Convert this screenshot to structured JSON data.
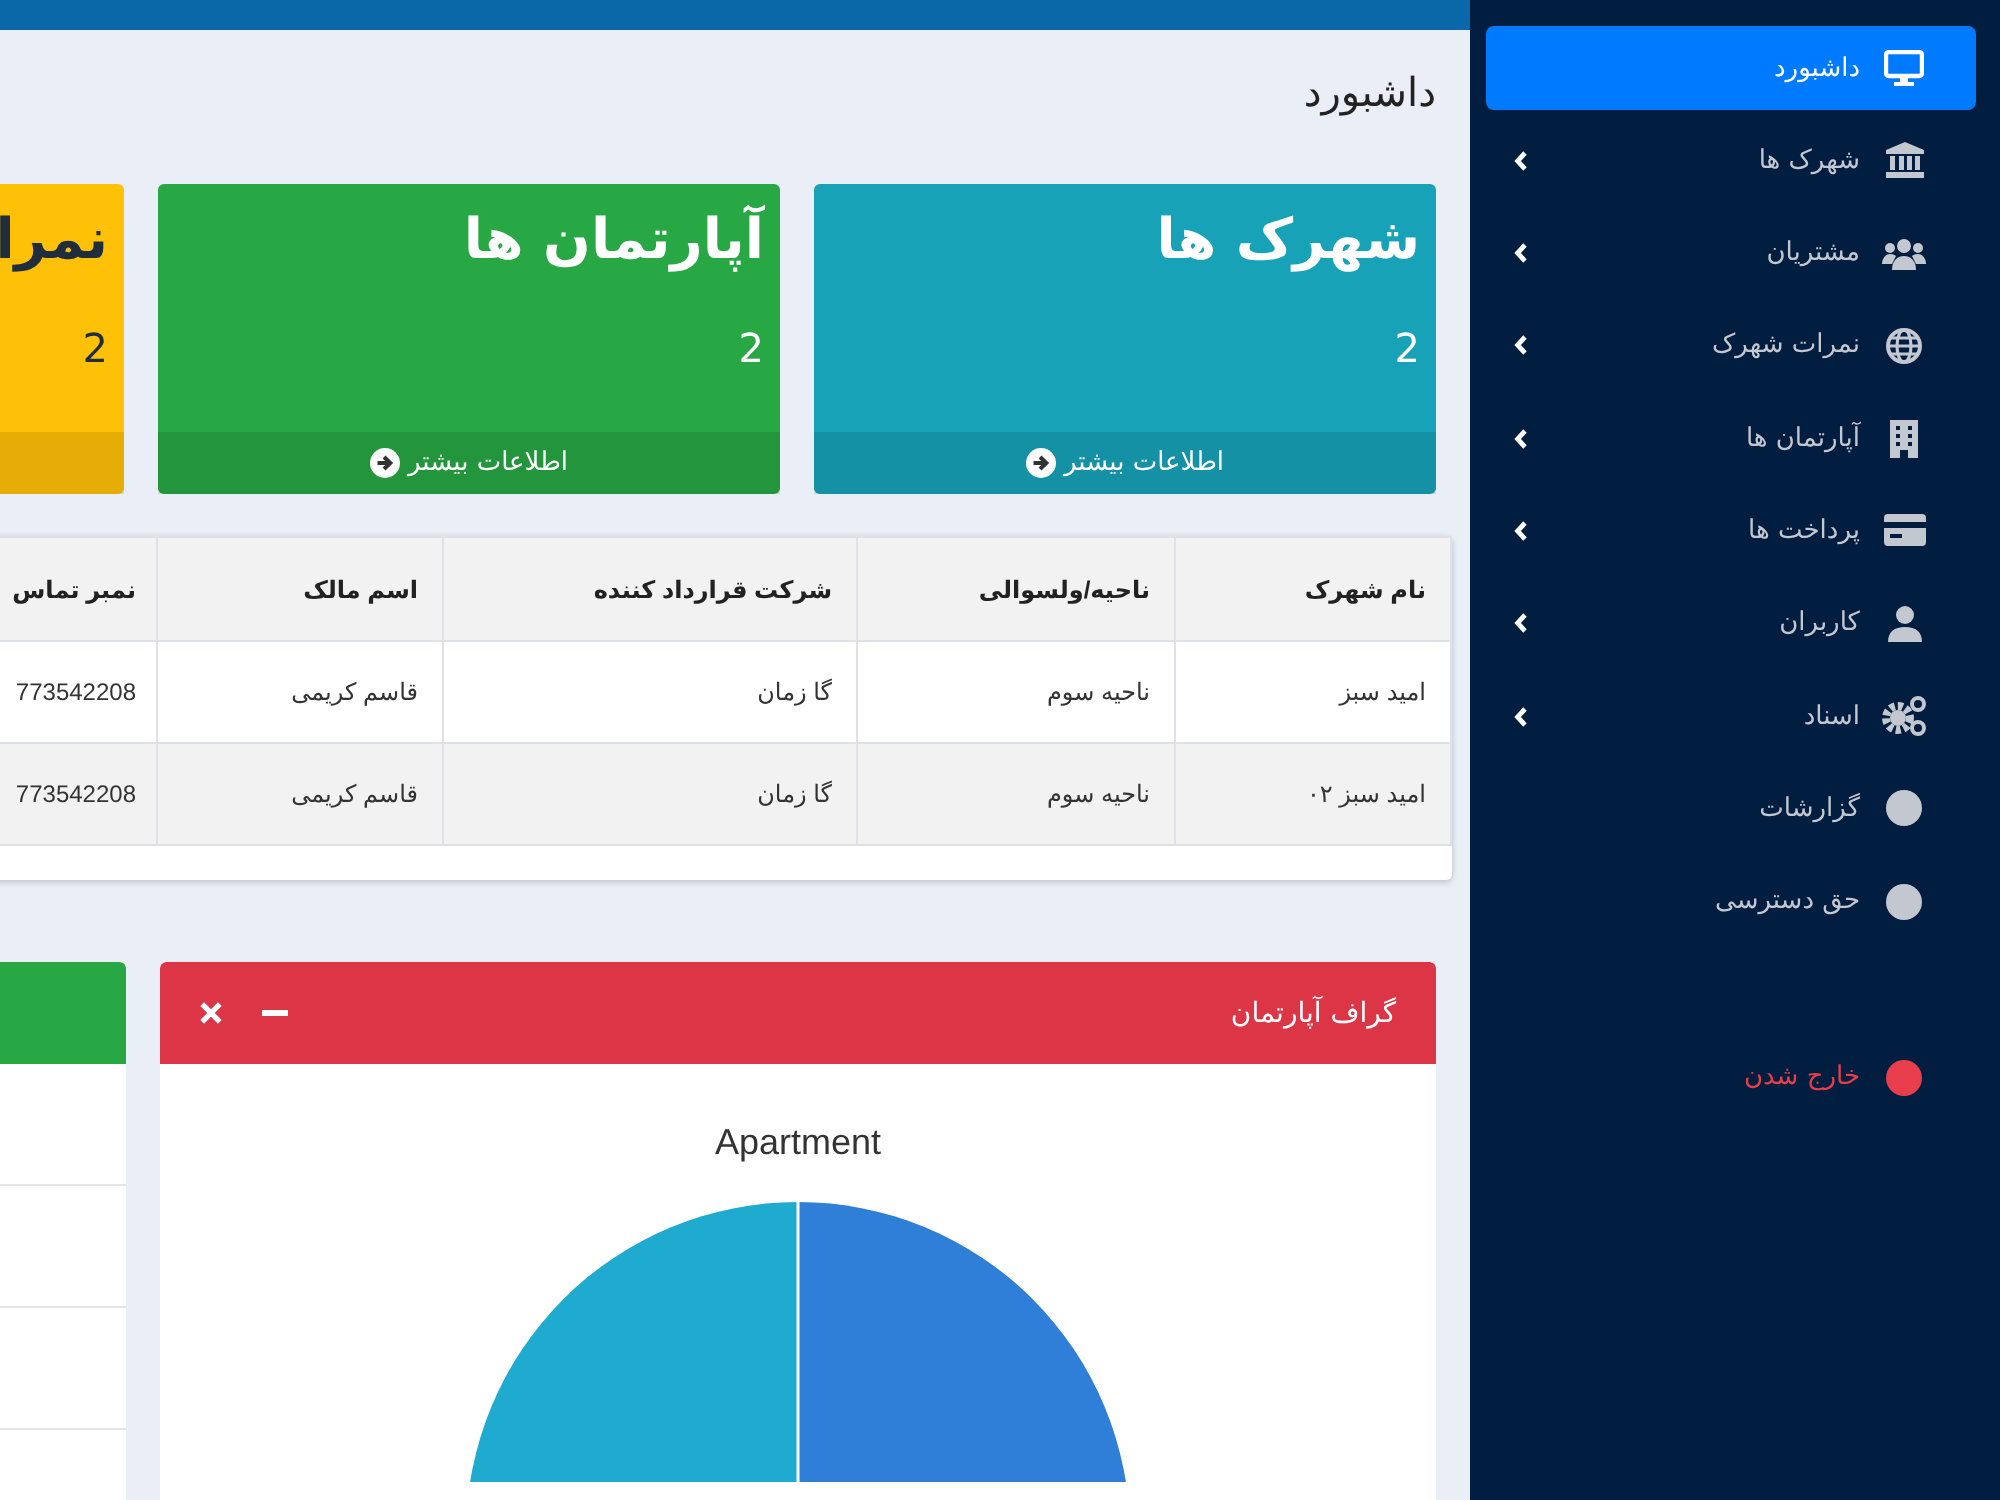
{
  "page_title": "داشبورد",
  "stat_cards": [
    {
      "title": "شهرک ها",
      "count": "2",
      "link": "اطلاعات بیشتر",
      "color": "#17a2b8"
    },
    {
      "title": "آپارتمان ها",
      "count": "2",
      "link": "اطلاعات بیشتر",
      "color": "#28a745"
    },
    {
      "title": "نمرا",
      "count": "2",
      "color": "#ffc107"
    }
  ],
  "table": {
    "columns": [
      "نام شهرک",
      "ناحیه/ولسوالی",
      "شرکت قرارداد کننده",
      "اسم مالک",
      "نمبر تماس"
    ],
    "rows": [
      [
        "امید سبز",
        "ناحیه سوم",
        "گا زمان",
        "قاسم کریمی",
        "773542208"
      ],
      [
        "امید سبز ۰۲",
        "ناحیه سوم",
        "گا زمان",
        "قاسم کریمی",
        "773542208"
      ]
    ]
  },
  "panels": [
    {
      "title": "گراف آپارتمان",
      "color": "#dc3545",
      "chart_title": "Apartment"
    },
    {
      "color": "#28a745"
    }
  ],
  "sidebar": {
    "items": [
      {
        "label": "داشبورد",
        "selected": true,
        "submenu": false
      },
      {
        "label": "شهرک ها",
        "selected": false,
        "submenu": true
      },
      {
        "label": "مشتریان",
        "selected": false,
        "submenu": true
      },
      {
        "label": "نمرات شهرک",
        "selected": false,
        "submenu": true
      },
      {
        "label": "آپارتمان ها",
        "selected": false,
        "submenu": true
      },
      {
        "label": "پرداخت ها",
        "selected": false,
        "submenu": true
      },
      {
        "label": "کاربران",
        "selected": false,
        "submenu": true
      },
      {
        "label": "اسناد",
        "selected": false,
        "submenu": true
      },
      {
        "label": "گزارشات",
        "selected": false,
        "submenu": false
      },
      {
        "label": "حق دسترسی",
        "selected": false,
        "submenu": false
      }
    ],
    "logout": {
      "label": "خارج شدن"
    }
  }
}
